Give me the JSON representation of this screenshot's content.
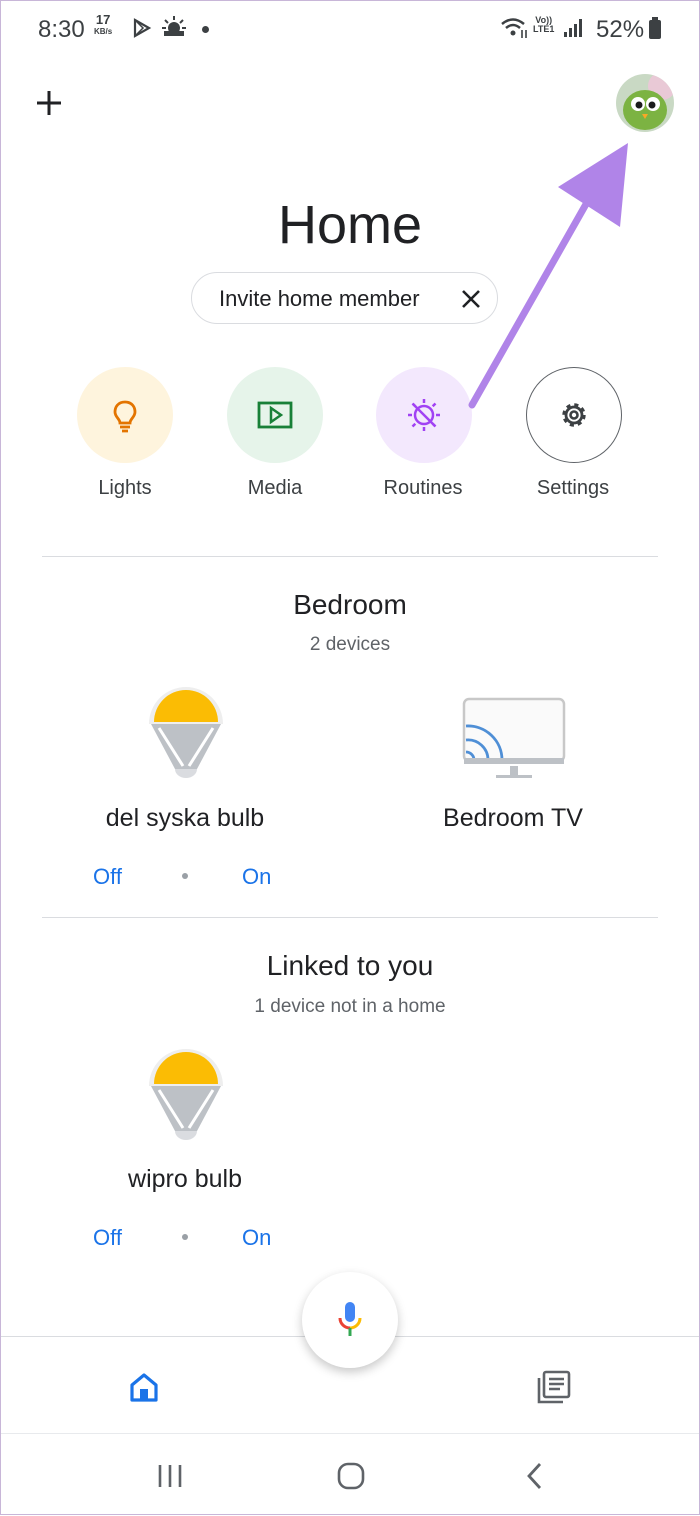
{
  "status_bar": {
    "time": "8:30",
    "speed_value": "17",
    "speed_unit": "KB/s",
    "volte_top": "Vo))",
    "volte_bottom": "LTE1",
    "battery_text": "52%"
  },
  "header": {
    "add_icon": "plus-icon",
    "avatar": "profile-avatar"
  },
  "page_title": "Home",
  "invite_chip": {
    "label": "Invite home member",
    "close_icon": "close-icon"
  },
  "shortcuts": [
    {
      "label": "Lights",
      "icon": "lightbulb-icon",
      "bg": "#fef4dd",
      "color": "#e37400"
    },
    {
      "label": "Media",
      "icon": "play-icon",
      "bg": "#e6f4ea",
      "color": "#188038"
    },
    {
      "label": "Routines",
      "icon": "routines-icon",
      "bg": "#f3e8fd",
      "color": "#a142f4"
    },
    {
      "label": "Settings",
      "icon": "gear-icon",
      "bg": "#ffffff",
      "color": "#5f6368"
    }
  ],
  "rooms": [
    {
      "title": "Bedroom",
      "subtitle": "2 devices",
      "devices": [
        {
          "name": "del syska bulb",
          "icon": "bulb-icon",
          "off_label": "Off",
          "on_label": "On"
        },
        {
          "name": "Bedroom TV",
          "icon": "cast-tv-icon"
        }
      ]
    },
    {
      "title": "Linked to you",
      "subtitle": "1 device not in a home",
      "devices": [
        {
          "name": "wipro bulb",
          "icon": "bulb-icon",
          "off_label": "Off",
          "on_label": "On"
        }
      ]
    }
  ],
  "bottom_nav": {
    "home_icon": "home-icon",
    "feed_icon": "feed-icon",
    "mic_icon": "mic-icon"
  },
  "colors": {
    "accent": "#1a73e8",
    "annotation_arrow": "#b084e8",
    "bulb_yellow": "#fbbc04"
  }
}
